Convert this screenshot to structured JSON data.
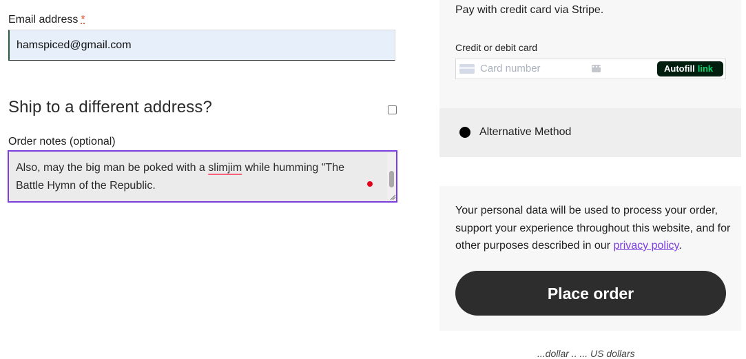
{
  "billing": {
    "email_label": "Email address",
    "required_mark": "*",
    "email_value": "hamspiced@gmail.com"
  },
  "shipping": {
    "title": "Ship to a different address?",
    "checked": false
  },
  "notes": {
    "label": "Order notes (optional)",
    "text_before": "Also, may the big man be poked with a ",
    "misspelled_word": "slimjim",
    "text_after": " while humming \"The Battle Hymn of the Republic."
  },
  "payment": {
    "description": "Pay with credit card via Stripe.",
    "card_label": "Credit or debit card",
    "card_placeholder": "Card number",
    "autofill_label": "Autofill",
    "autofill_brand": "link",
    "alt_method_label": "Alternative Method"
  },
  "privacy": {
    "text_before": "Your personal data will be used to process your order, support your experience throughout this website, and for other purposes described in our ",
    "link_text": "privacy policy",
    "text_after": "."
  },
  "order": {
    "place_order_label": "Place order",
    "footer_partial": "...dollar  ..  ...  US dollars"
  },
  "colors": {
    "accent": "#7b3ddb",
    "button_bg": "#2d2d2d",
    "link_brand": "#00d66f"
  }
}
